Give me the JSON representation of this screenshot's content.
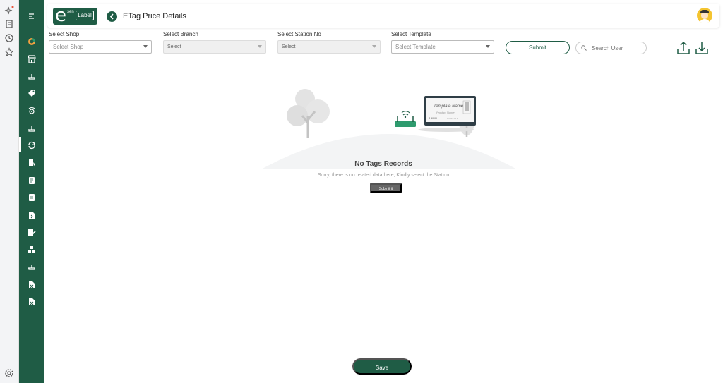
{
  "header": {
    "logo": {
      "e": "e",
      "sen": "sen",
      "label": "Label"
    },
    "title": "ETag Price Details"
  },
  "filters": {
    "shop": {
      "label": "Select Shop",
      "placeholder": "Select Shop"
    },
    "branch": {
      "label": "Select Branch",
      "value": "Select"
    },
    "station": {
      "label": "Select Station No",
      "value": "Select"
    },
    "template": {
      "label": "Select Template",
      "placeholder": "Select Template"
    },
    "submit_label": "Submit",
    "search_placeholder": "Search User"
  },
  "empty_state": {
    "card_title": "Template Name",
    "card_product": "Product Name",
    "card_price": "₹ 60.00",
    "card_caption": "Product Tax Id",
    "title": "No Tags Records",
    "subtitle": "Sorry, there is no related data here, Kindly select the Station",
    "button_label": "Submit it"
  },
  "footer": {
    "save_label": "Save"
  },
  "colors": {
    "brand": "#1f5c45",
    "accent": "#2e9b6e"
  }
}
